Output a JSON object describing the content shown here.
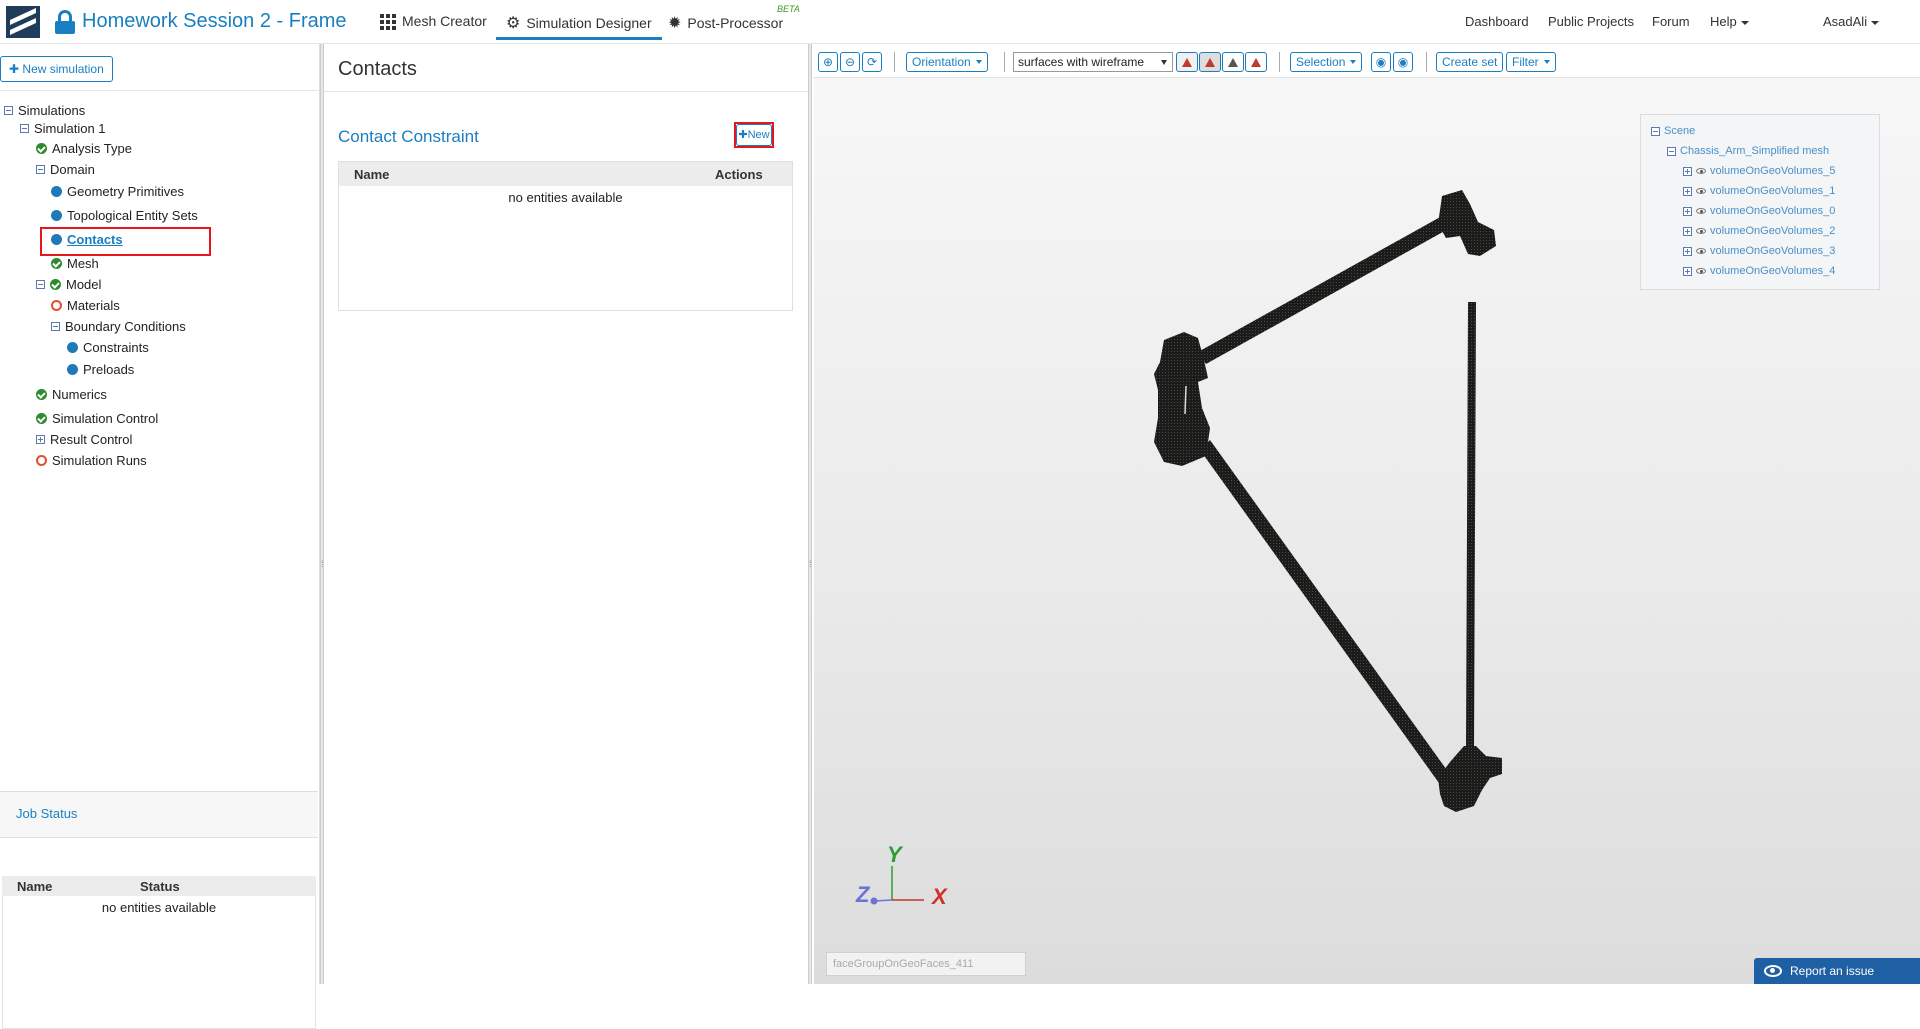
{
  "header": {
    "project_title": "Homework Session 2 - Frame",
    "tabs": [
      {
        "label": "Mesh Creator"
      },
      {
        "label": "Simulation Designer"
      },
      {
        "label": "Post-Processor"
      }
    ],
    "beta_badge": "BETA",
    "links": [
      "Dashboard",
      "Public Projects",
      "Forum",
      "Help"
    ],
    "user": "AsadAli"
  },
  "sidebar": {
    "new_simulation_label": "New simulation",
    "tree": {
      "simulations": "Simulations",
      "simulation_1": "Simulation 1",
      "analysis_type": "Analysis Type",
      "domain": "Domain",
      "geometry_primitives": "Geometry Primitives",
      "topological_entity_sets": "Topological Entity Sets",
      "contacts": "Contacts",
      "mesh": "Mesh",
      "model": "Model",
      "materials": "Materials",
      "boundary_conditions": "Boundary Conditions",
      "constraints": "Constraints",
      "preloads": "Preloads",
      "numerics": "Numerics",
      "simulation_control": "Simulation Control",
      "result_control": "Result Control",
      "simulation_runs": "Simulation Runs"
    },
    "job_status": {
      "title": "Job Status",
      "columns": [
        "Name",
        "Status"
      ],
      "empty": "no entities available"
    }
  },
  "main": {
    "title": "Contacts",
    "section_title": "Contact Constraint",
    "new_label": "New",
    "columns": [
      "Name",
      "Actions"
    ],
    "empty": "no entities available"
  },
  "viewer": {
    "orientation_label": "Orientation",
    "render_mode": "surfaces with wireframe",
    "selection_label": "Selection",
    "create_set_label": "Create set",
    "filter_label": "Filter",
    "scene": {
      "root": "Scene",
      "mesh": "Chassis_Arm_Simplified mesh",
      "volumes": [
        "volumeOnGeoVolumes_5",
        "volumeOnGeoVolumes_1",
        "volumeOnGeoVolumes_0",
        "volumeOnGeoVolumes_2",
        "volumeOnGeoVolumes_3",
        "volumeOnGeoVolumes_4"
      ]
    },
    "axes": {
      "x": "X",
      "y": "Y",
      "z": "Z"
    },
    "face_placeholder": "faceGroupOnGeoFaces_411",
    "report_label": "Report an issue"
  },
  "colors": {
    "accent": "#1a7fc1",
    "success": "#2d8a2d",
    "danger": "#e5161c",
    "warning": "#e0502e"
  }
}
